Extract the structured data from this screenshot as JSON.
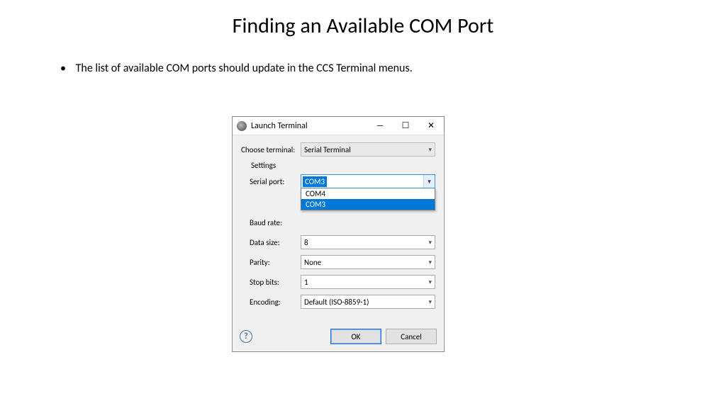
{
  "slide": {
    "title": "Finding an Available COM Port",
    "bullet": "The list of available COM ports should update in the CCS Terminal menus."
  },
  "dialog": {
    "title": "Launch Terminal",
    "choose_terminal_label": "Choose terminal:",
    "choose_terminal_value": "Serial Terminal",
    "settings_label": "Settings",
    "serial_port_label": "Serial port:",
    "serial_port_value": "COM3",
    "serial_port_options": {
      "opt1": "COM4",
      "opt2": "COM3"
    },
    "baud_label": "Baud rate:",
    "baud_value": "",
    "data_size_label": "Data size:",
    "data_size_value": "8",
    "parity_label": "Parity:",
    "parity_value": "None",
    "stop_bits_label": "Stop bits:",
    "stop_bits_value": "1",
    "encoding_label": "Encoding:",
    "encoding_value": "Default (ISO-8859-1)",
    "ok_label": "OK",
    "cancel_label": "Cancel"
  }
}
